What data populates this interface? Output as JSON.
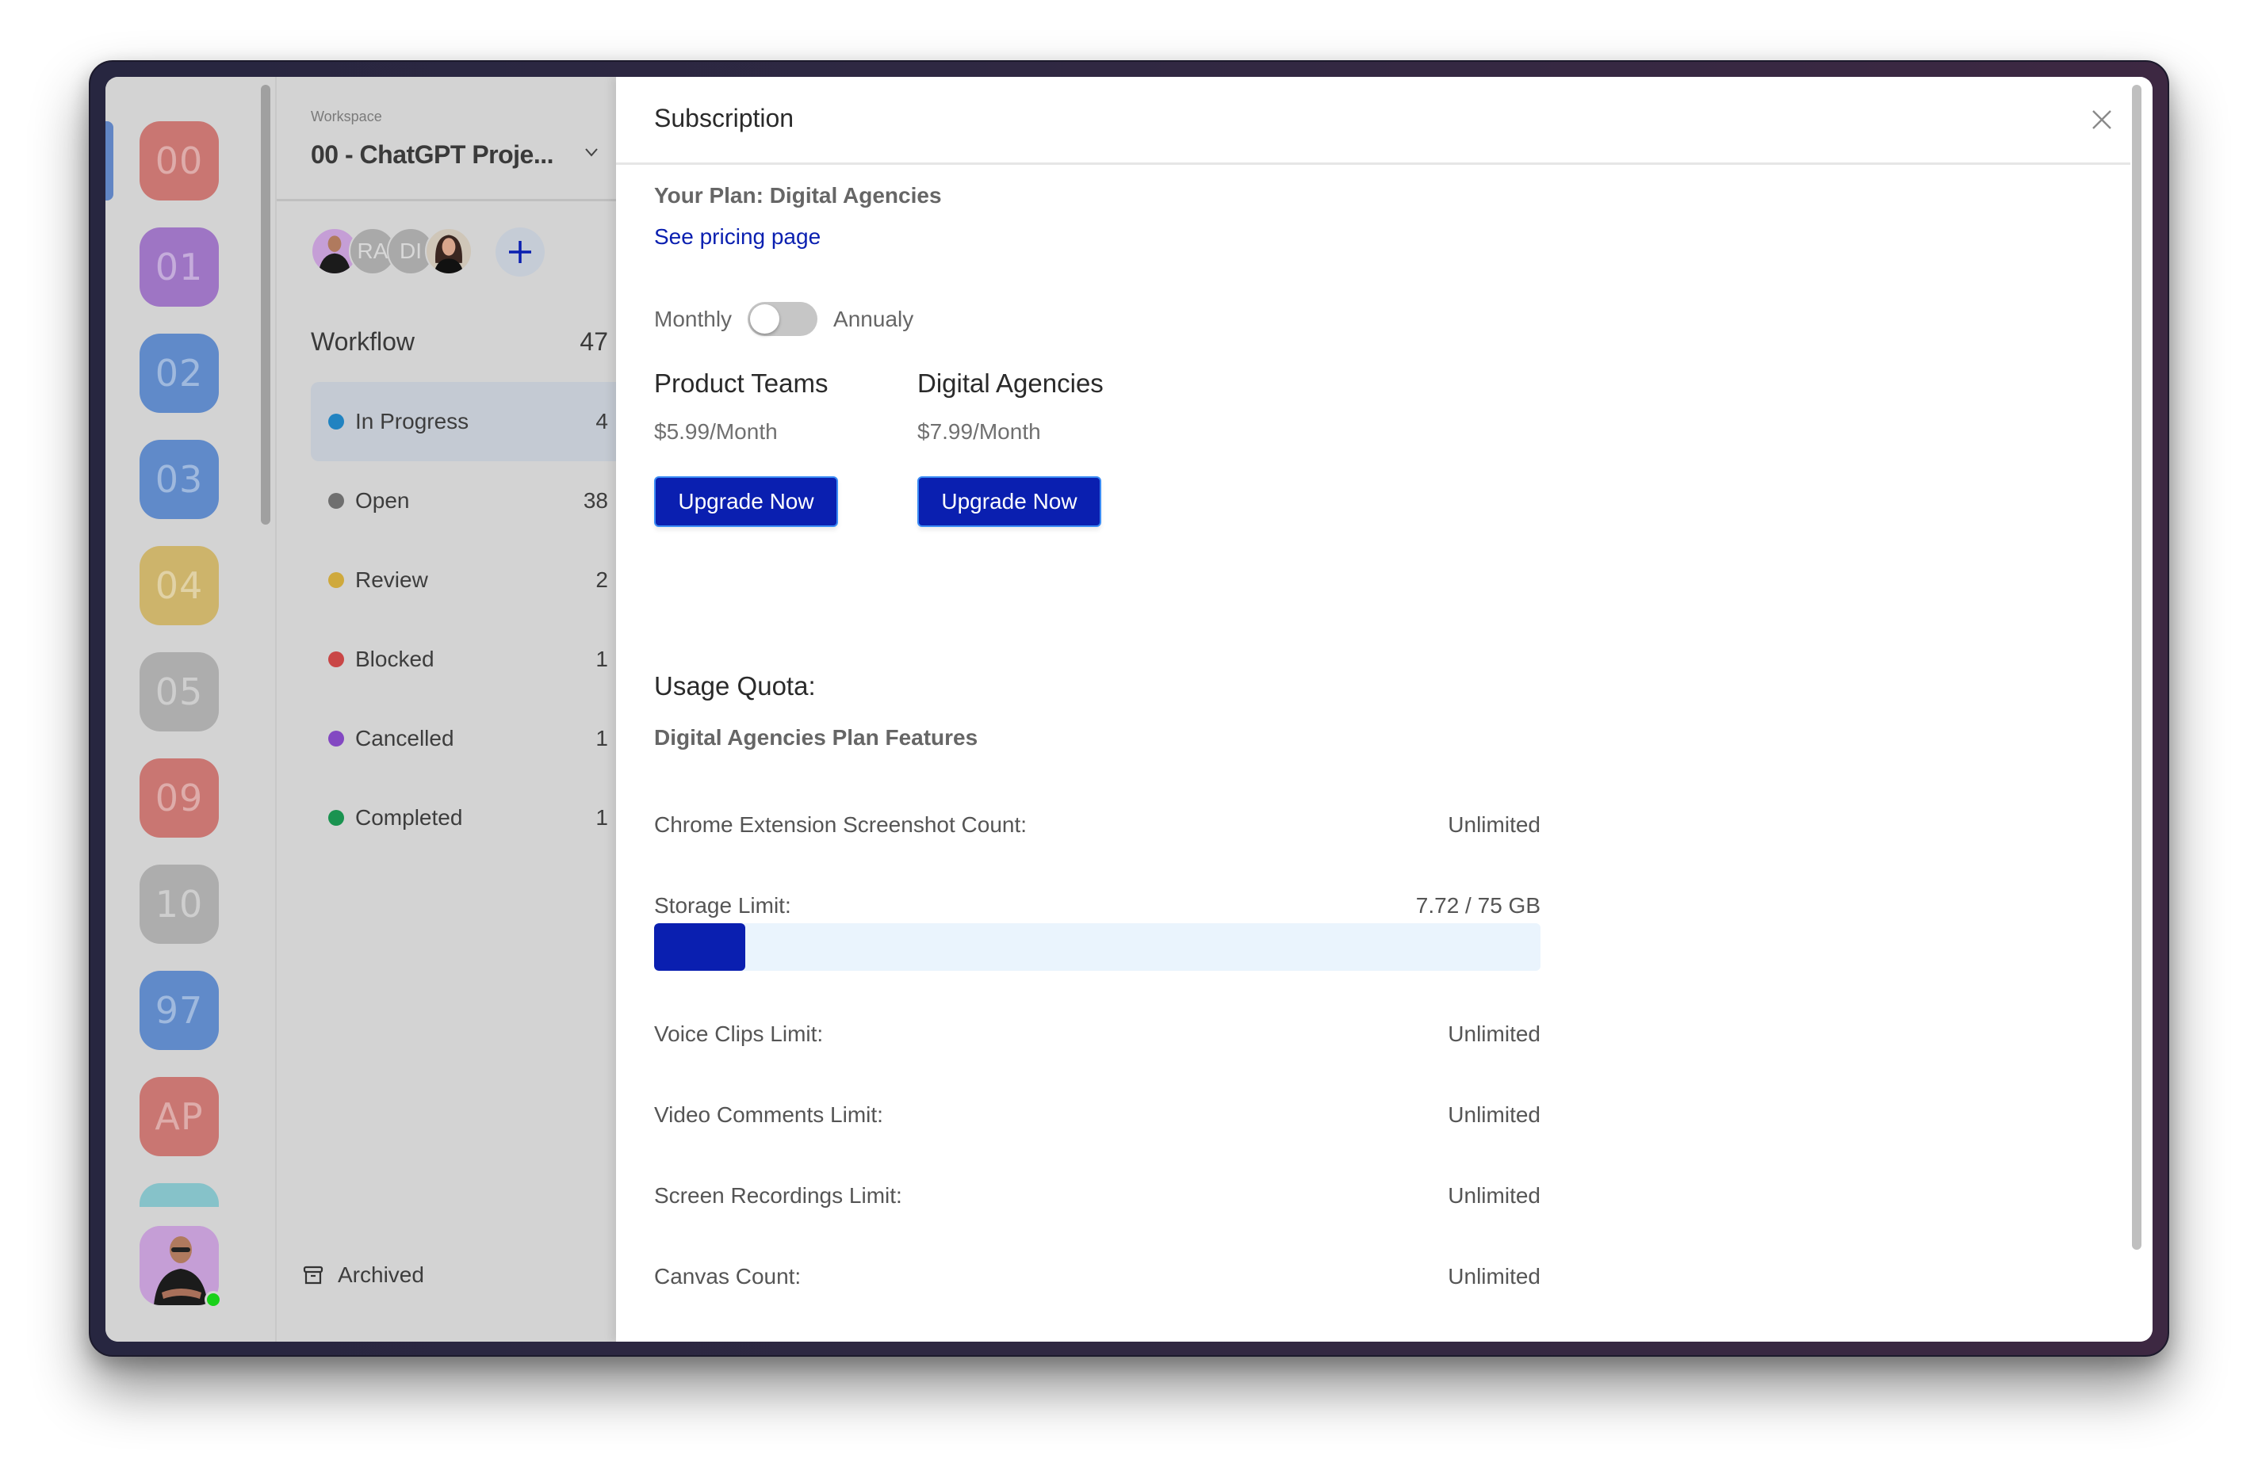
{
  "tiles": {
    "items": [
      {
        "label": "00",
        "color": "#c97672"
      },
      {
        "label": "01",
        "color": "#9e75c4"
      },
      {
        "label": "02",
        "color": "#608ac9"
      },
      {
        "label": "03",
        "color": "#608ac9"
      },
      {
        "label": "04",
        "color": "#cdb46b"
      },
      {
        "label": "05",
        "color": "#adadad"
      },
      {
        "label": "09",
        "color": "#c97672"
      },
      {
        "label": "10",
        "color": "#adadad"
      },
      {
        "label": "97",
        "color": "#608ac9"
      },
      {
        "label": "AP",
        "color": "#c97672"
      },
      {
        "label": "",
        "color": "#86c2c9"
      }
    ],
    "selected_index": 0,
    "current_user": {
      "status": "online",
      "status_color": "#19d119"
    }
  },
  "workspace": {
    "label": "Workspace",
    "name": "00 - ChatGPT Proje...",
    "members": [
      {
        "type": "photo",
        "initials": ""
      },
      {
        "type": "initials",
        "initials": "RA"
      },
      {
        "type": "initials",
        "initials": "DI"
      },
      {
        "type": "photo",
        "initials": ""
      }
    ],
    "add_member_icon": "plus-icon",
    "workflow": {
      "title": "Workflow",
      "total": "47",
      "items": [
        {
          "label": "In Progress",
          "count": "4",
          "color": "#2183c1",
          "active": true
        },
        {
          "label": "Open",
          "count": "38",
          "color": "#6f6f6f",
          "active": false
        },
        {
          "label": "Review",
          "count": "2",
          "color": "#cfa93c",
          "active": false
        },
        {
          "label": "Blocked",
          "count": "1",
          "color": "#c94646",
          "active": false
        },
        {
          "label": "Cancelled",
          "count": "1",
          "color": "#8348c2",
          "active": false
        },
        {
          "label": "Completed",
          "count": "1",
          "color": "#1a9350",
          "active": false
        }
      ]
    },
    "archived_label": "Archived"
  },
  "subscription": {
    "title": "Subscription",
    "your_plan": "Your Plan: Digital Agencies",
    "pricing_link": "See pricing page",
    "billing": {
      "monthly_label": "Monthly",
      "annual_label": "Annualy",
      "annual_selected": false
    },
    "plans": [
      {
        "name": "Product Teams",
        "price": "$5.99/Month",
        "button": "Upgrade Now"
      },
      {
        "name": "Digital Agencies",
        "price": "$7.99/Month",
        "button": "Upgrade Now"
      }
    ],
    "usage_title": "Usage Quota:",
    "features_title": "Digital Agencies Plan Features",
    "features": [
      {
        "label": "Chrome Extension Screenshot Count:",
        "value": "Unlimited"
      },
      {
        "label": "Storage Limit:",
        "value": "7.72 / 75 GB"
      },
      {
        "label": "Voice Clips Limit:",
        "value": "Unlimited"
      },
      {
        "label": "Video Comments Limit:",
        "value": "Unlimited"
      },
      {
        "label": "Screen Recordings Limit:",
        "value": "Unlimited"
      },
      {
        "label": "Canvas Count:",
        "value": "Unlimited"
      }
    ],
    "storage": {
      "used_gb": 7.72,
      "total_gb": 75,
      "fraction": 0.103
    },
    "accent_color": "#0a1fb0",
    "link_color": "#0a1fb0"
  }
}
